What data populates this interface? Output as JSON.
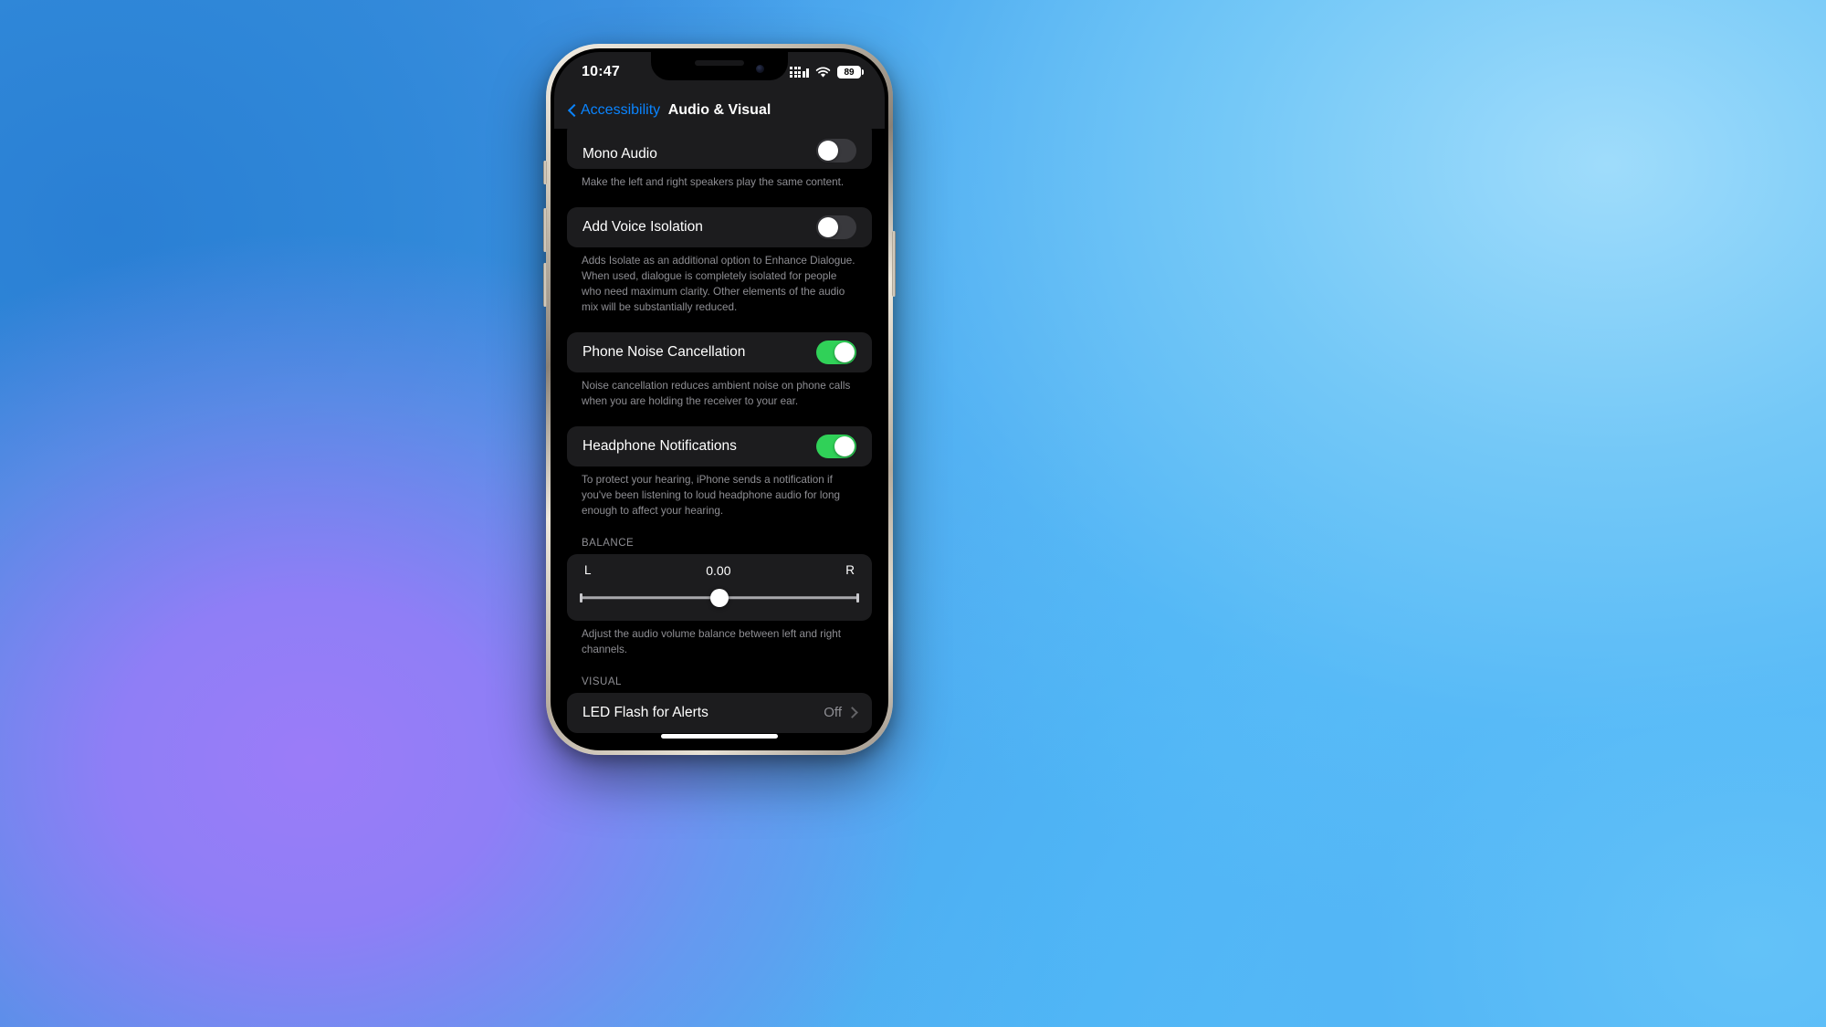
{
  "wallpaper": {
    "color_top_left": "#2e86d8",
    "color_bottom_left": "#8f7ef6",
    "color_right": "#63c2f8"
  },
  "status_bar": {
    "time": "10:47",
    "battery_level": "89",
    "signal_icon": "cellular-signal-icon",
    "wifi_icon": "wifi-icon",
    "battery_icon": "battery-icon"
  },
  "nav_bar": {
    "back_label": "Accessibility",
    "back_icon": "chevron-left-icon",
    "title": "Audio & Visual"
  },
  "settings": {
    "mono_audio": {
      "label": "Mono Audio",
      "toggle_state": "off",
      "footnote": "Make the left and right speakers play the same content."
    },
    "add_voice_isolation": {
      "label": "Add Voice Isolation",
      "toggle_state": "off",
      "footnote": "Adds Isolate as an additional option to Enhance Dialogue. When used, dialogue is completely isolated for people who need maximum clarity. Other elements of the audio mix will be substantially reduced."
    },
    "phone_noise_cancellation": {
      "label": "Phone Noise Cancellation",
      "toggle_state": "on",
      "footnote": "Noise cancellation reduces ambient noise on phone calls when you are holding the receiver to your ear."
    },
    "headphone_notifications": {
      "label": "Headphone Notifications",
      "toggle_state": "on",
      "footnote": "To protect your hearing, iPhone sends a notification if you've been listening to loud headphone audio for long enough to affect your hearing."
    },
    "balance": {
      "section_header": "BALANCE",
      "left_label": "L",
      "value": "0.00",
      "right_label": "R",
      "slider_percent": 50,
      "footnote": "Adjust the audio volume balance between left and right channels."
    },
    "visual": {
      "section_header": "VISUAL",
      "led_flash": {
        "label": "LED Flash for Alerts",
        "value": "Off",
        "chevron_icon": "chevron-right-icon"
      }
    }
  },
  "accent_colors": {
    "link": "#0a84ff",
    "toggle_on": "#30d158",
    "toggle_off": "#39393d"
  },
  "home_indicator": "home-indicator"
}
